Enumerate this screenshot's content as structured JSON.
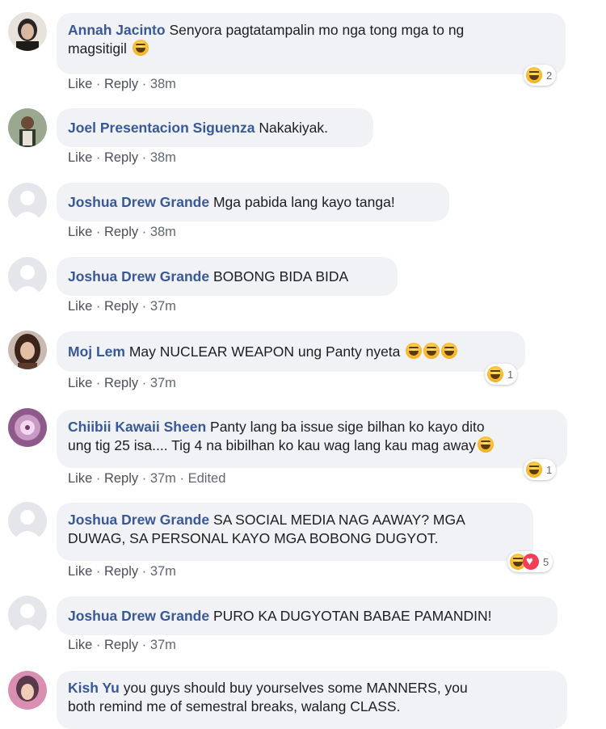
{
  "comments": [
    {
      "author": "Annah Jacinto",
      "text": "Senyora pagtatampalin mo nga tong mga to ng magsitigil",
      "line1": "Senyora pagtatampalin mo nga tong mga to ng",
      "line2": "magsitigil",
      "like": "Like",
      "reply": "Reply",
      "time": "38m",
      "reaction_count": "2"
    },
    {
      "author": "Joel Presentacion Siguenza",
      "text": "Nakakiyak.",
      "like": "Like",
      "reply": "Reply",
      "time": "38m"
    },
    {
      "author": "Joshua Drew Grande",
      "text": "Mga pabida lang kayo tanga!",
      "like": "Like",
      "reply": "Reply",
      "time": "38m"
    },
    {
      "author": "Joshua Drew Grande",
      "text": "BOBONG BIDA BIDA",
      "like": "Like",
      "reply": "Reply",
      "time": "37m"
    },
    {
      "author": "Moj Lem",
      "text": "May NUCLEAR WEAPON ung Panty nyeta",
      "like": "Like",
      "reply": "Reply",
      "time": "37m",
      "reaction_count": "1"
    },
    {
      "author": "Chiibii Kawaii Sheen",
      "line1": "Panty lang ba issue sige bilhan ko kayo dito",
      "line2": "ung tig 25 isa.... Tig 4 na bibilhan ko kau wag lang kau mag away",
      "like": "Like",
      "reply": "Reply",
      "time": "37m",
      "edited": "Edited",
      "reaction_count": "1"
    },
    {
      "author": "Joshua Drew Grande",
      "line1": "SA SOCIAL MEDIA NAG AAWAY? MGA",
      "line2": "DUWAG, SA PERSONAL KAYO MGA BOBONG DUGYOT.",
      "like": "Like",
      "reply": "Reply",
      "time": "37m",
      "reaction_count": "5"
    },
    {
      "author": "Joshua Drew Grande",
      "text": "PURO KA DUGYOTAN BABAE PAMANDIN!",
      "like": "Like",
      "reply": "Reply",
      "time": "37m"
    },
    {
      "author": "Kish Yu",
      "line1": "you guys should buy yourselves some MANNERS, you",
      "line2": "both remind me of semestral breaks, walang CLASS."
    }
  ],
  "separator": " · ",
  "icons": {
    "laugh": "haha-emoji-icon",
    "love": "love-reaction-icon",
    "avatar": "profile-avatar"
  },
  "colors": {
    "author": "#385898",
    "bubble": "#f0f2f5",
    "meta": "#606770"
  }
}
